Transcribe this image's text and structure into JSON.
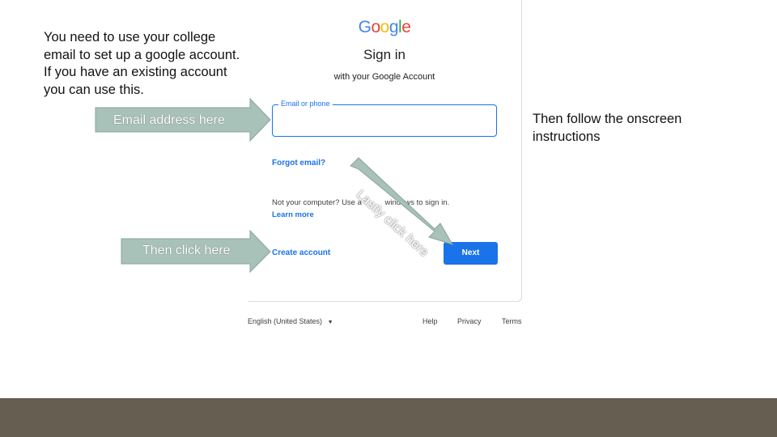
{
  "instructions": {
    "intro": "You need to use your college email to set up a google account.  If you have an existing account you can use this.",
    "follow": "Then follow the onscreen instructions"
  },
  "google_card": {
    "logo_letters": [
      {
        "char": "G",
        "color": "#4285f4"
      },
      {
        "char": "o",
        "color": "#ea4335"
      },
      {
        "char": "o",
        "color": "#fbbc05"
      },
      {
        "char": "g",
        "color": "#4285f4"
      },
      {
        "char": "l",
        "color": "#34a853"
      },
      {
        "char": "e",
        "color": "#ea4335"
      }
    ],
    "title": "Sign in",
    "subtitle": "with your Google Account",
    "email_label": "Email or phone",
    "forgot_email": "Forgot email?",
    "not_your_computer": "Not your computer? Use a",
    "not_your_computer_tail": "windows to sign in.",
    "learn_more": "Learn more",
    "create_account": "Create account",
    "next_button": "Next",
    "footer": {
      "language": "English (United States)",
      "help": "Help",
      "privacy": "Privacy",
      "terms": "Terms"
    }
  },
  "callouts": {
    "email_arrow": "Email address here",
    "create_arrow": "Then click here",
    "next_arrow": "Lastly click here"
  },
  "colors": {
    "accent": "#1a73e8",
    "arrow_fill": "#a8c1b9",
    "footer_bar": "#665e50"
  }
}
